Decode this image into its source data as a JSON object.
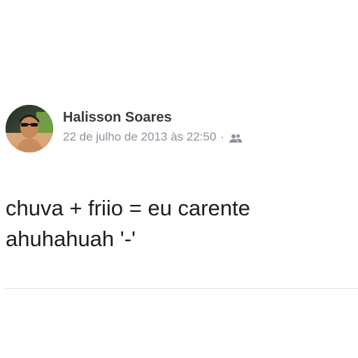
{
  "post": {
    "author": "Halisson Soares",
    "timestamp": "22 de julho de 2013 às 22:50",
    "separator": "·",
    "audience_icon": "friends-icon",
    "text": "chuva + friio = eu carente\nahuhahuah '-'"
  },
  "colors": {
    "author": "#3b3b3b",
    "meta": "#8d949e",
    "text": "#1c1e21",
    "divider": "#e2e4e8"
  }
}
